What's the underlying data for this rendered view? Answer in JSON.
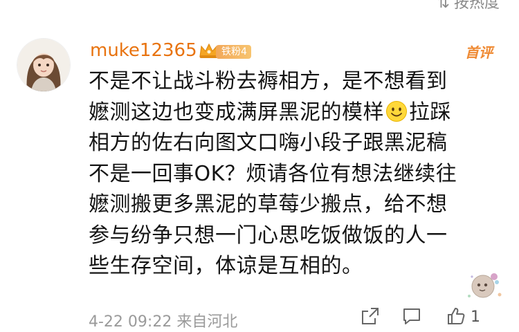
{
  "sort_bar": {
    "label": "按热度"
  },
  "comment": {
    "username": "muke12365",
    "fan_badge": "铁粉4",
    "hot_badge": "首评",
    "lines": [
      "不是不让战斗粉去褥相方，是不想看到",
      "嬷测这边也变成满屏黑泥的模样",
      "相方的佐右向图文口嗨小段子跟黑泥稿",
      "不是一回事OK？烦请各位有想法继续往",
      "嬷测搬更多黑泥的草莓少搬点，给不想",
      "参与纷争只想一门心思吃饭做饭的人一",
      "些生存空间，体谅是互相的。"
    ],
    "line2_tail": "拉踩",
    "emoji_icon": "smile-emoji-icon",
    "date": "4-22 09:22",
    "source": "来自河北",
    "like_count": "1"
  },
  "colors": {
    "username": "#e8730f",
    "badge": "#f2a85a",
    "meta": "#9a9a9a"
  }
}
